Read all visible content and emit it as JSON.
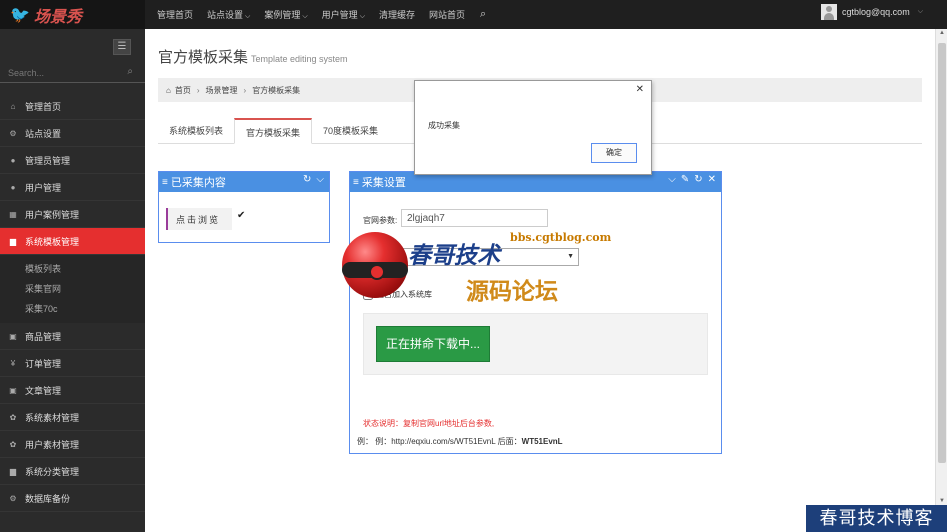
{
  "header": {
    "brand": "场景秀",
    "nav": [
      "管理首页",
      "站点设置",
      "案例管理",
      "用户管理",
      "清理缓存",
      "网站首页"
    ],
    "nav_dropdown": [
      false,
      true,
      true,
      true,
      false,
      false
    ],
    "user_email": "cgtblog@qq.com"
  },
  "sidebar": {
    "search_placeholder": "Search...",
    "items": [
      {
        "label": "管理首页",
        "icon": "home-icon",
        "glyph": "⌂"
      },
      {
        "label": "站点设置",
        "icon": "cogs-icon",
        "glyph": "⚙"
      },
      {
        "label": "管理员管理",
        "icon": "user-icon",
        "glyph": "●"
      },
      {
        "label": "用户管理",
        "icon": "user-icon",
        "glyph": "●"
      },
      {
        "label": "用户案例管理",
        "icon": "table-icon",
        "glyph": "▦"
      },
      {
        "label": "系统模板管理",
        "icon": "briefcase-icon",
        "glyph": "▆",
        "active": true
      },
      {
        "label": "商品管理",
        "icon": "square-icon",
        "glyph": "▣"
      },
      {
        "label": "订单管理",
        "icon": "yen-icon",
        "glyph": "¥"
      },
      {
        "label": "文章管理",
        "icon": "square-icon",
        "glyph": "▣"
      },
      {
        "label": "系统素材管理",
        "icon": "gift-icon",
        "glyph": "✿"
      },
      {
        "label": "用户素材管理",
        "icon": "gift-icon",
        "glyph": "✿"
      },
      {
        "label": "系统分类管理",
        "icon": "briefcase-icon",
        "glyph": "▆"
      },
      {
        "label": "数据库备份",
        "icon": "cogs-icon",
        "glyph": "⚙"
      }
    ],
    "submenu": [
      "模板列表",
      "采集官网",
      "采集70c"
    ]
  },
  "page": {
    "title": "官方模板采集",
    "subtitle": "Template editing system",
    "breadcrumb": [
      "首页",
      "场景管理",
      "官方模板采集"
    ],
    "tabs": [
      "系统模板列表",
      "官方模板采集",
      "70度模板采集"
    ],
    "active_tab": 1
  },
  "panel_collected": {
    "title": "已采集内容",
    "browse_label": "点击浏览"
  },
  "panel_settings": {
    "title": "采集设置",
    "param_label": "官网参数:",
    "param_value": "2lgjaqh7",
    "checkbox_label": "是否加入系统库",
    "download_button": "正在拼命下载中...",
    "status_note": "状态说明：复制官网url地址后台参数,",
    "example_prefix": "例： 例：http://eqxiu.com/s/WT51EvnL 后面：",
    "example_code": "WT51EvnL"
  },
  "dialog": {
    "message": "成功采集",
    "ok_label": "确定"
  },
  "watermark": {
    "line1": "春哥技术",
    "url": "bbs.cgtblog.com",
    "line2": "源码论坛",
    "corner": "春哥技术博客"
  },
  "colors": {
    "topbar": "#1f1f1f",
    "sidebar": "#2b2b2b",
    "active": "#e52f2f",
    "panel_header": "#4a90e2",
    "download": "#2a9a45"
  }
}
